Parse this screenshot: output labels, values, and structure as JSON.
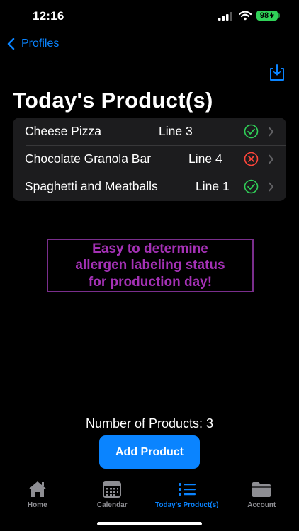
{
  "status_bar": {
    "time": "12:16",
    "battery": "98"
  },
  "nav": {
    "back_label": "Profiles"
  },
  "page": {
    "title": "Today's Product(s)"
  },
  "products": [
    {
      "name": "Cheese Pizza",
      "line": "Line 3",
      "status": "ok"
    },
    {
      "name": "Chocolate Granola Bar",
      "line": "Line 4",
      "status": "error"
    },
    {
      "name": "Spaghetti and Meatballs",
      "line": "Line 1",
      "status": "ok"
    }
  ],
  "callout": {
    "lines": [
      "Easy to determine",
      "allergen labeling status",
      "for production day!"
    ]
  },
  "summary": {
    "count_text": "Number of Products: 3"
  },
  "add_button": {
    "label": "Add Product"
  },
  "tabs": [
    {
      "label": "Home",
      "icon": "house-icon"
    },
    {
      "label": "Calendar",
      "icon": "calendar-icon"
    },
    {
      "label": "Today's Product(s)",
      "icon": "list-icon",
      "active": true
    },
    {
      "label": "Account",
      "icon": "folder-icon"
    }
  ],
  "colors": {
    "accent": "#0a84ff",
    "ok": "#30d158",
    "error": "#ff453a",
    "callout": "#a431b5"
  }
}
